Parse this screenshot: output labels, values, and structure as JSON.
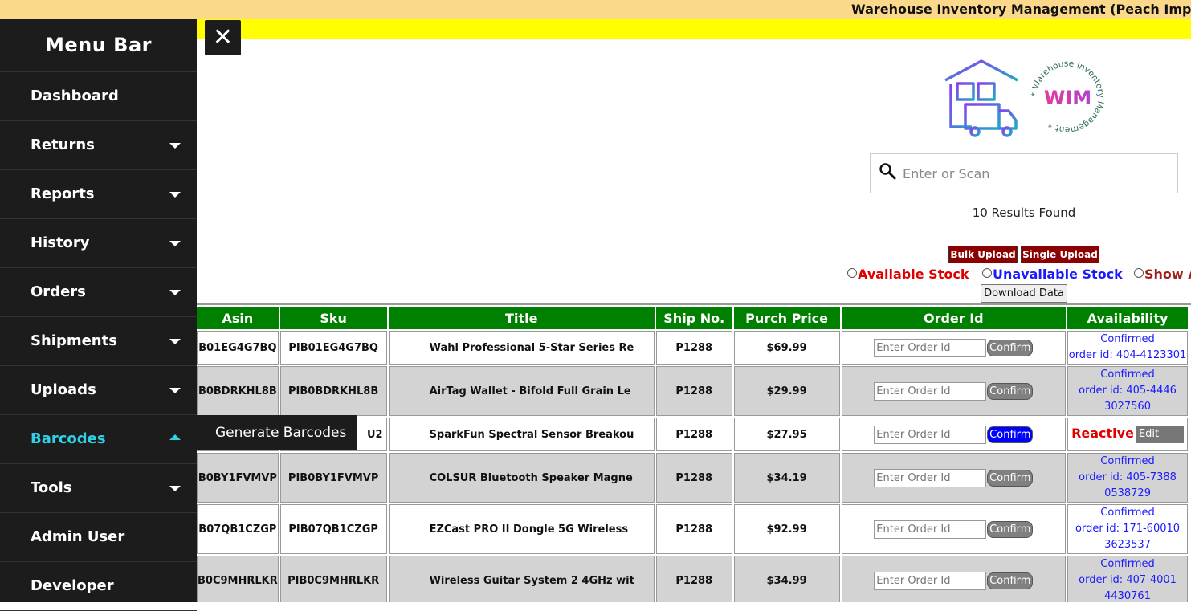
{
  "banner": {
    "title": "Warehouse Inventory Management (Peach Imports"
  },
  "sidebar": {
    "title": "Menu Bar",
    "items": [
      {
        "label": "Dashboard"
      },
      {
        "label": "Returns"
      },
      {
        "label": "Reports"
      },
      {
        "label": "History"
      },
      {
        "label": "Orders"
      },
      {
        "label": "Shipments"
      },
      {
        "label": "Uploads"
      },
      {
        "label": "Barcodes"
      },
      {
        "label": "Tools"
      },
      {
        "label": "Admin User"
      },
      {
        "label": "Developer"
      }
    ],
    "submenu_item": "Generate Barcodes",
    "active_color": "#2fd0e8"
  },
  "close_symbol": "✕",
  "logo": {
    "wim_text": "WIM",
    "wim_ring_text": "* Warehouse Inventory Management *"
  },
  "search": {
    "placeholder": "Enter or Scan"
  },
  "results_text": "10 Results Found",
  "buttons": {
    "bulk_upload": "Bulk Upload",
    "single_upload": "Single Upload",
    "download": "Download Data"
  },
  "filters": {
    "available": "Available Stock",
    "unavailable": "Unavailable Stock",
    "show_all": "Show A"
  },
  "table": {
    "headers": [
      "Asin",
      "Sku",
      "Title",
      "Ship No.",
      "Purch Price",
      "Order Id",
      "Availability"
    ],
    "order_placeholder": "Enter Order Id",
    "confirm_label": "Confirm",
    "edit_label": "Edit",
    "rows": [
      {
        "asin": "B01EG4G7BQ",
        "sku": "PIB01EG4G7BQ",
        "title": "Wahl Professional 5-Star Series Re",
        "ship": "P1288",
        "price": "$69.99",
        "avail1": "Confirmed",
        "avail2": "order id: 404-4123301",
        "avail3": ""
      },
      {
        "asin": "B0BDRKHL8B",
        "sku": "PIB0BDRKHL8B",
        "title": "AirTag Wallet - Bifold Full Grain Le",
        "ship": "P1288",
        "price": "$29.99",
        "avail1": "Confirmed",
        "avail2": "order id: 405-4446",
        "avail3": "3027560"
      },
      {
        "asin": "",
        "sku": "U2",
        "title": "SparkFun Spectral Sensor Breakou",
        "ship": "P1288",
        "price": "$27.95",
        "avail1": "Reactive",
        "avail2": "",
        "avail3": ""
      },
      {
        "asin": "B0BY1FVMVP",
        "sku": "PIB0BY1FVMVP",
        "title": "COLSUR Bluetooth Speaker  Magne",
        "ship": "P1288",
        "price": "$34.19",
        "avail1": "Confirmed",
        "avail2": "order id: 405-7388",
        "avail3": "0538729"
      },
      {
        "asin": "B07QB1CZGP",
        "sku": "PIB07QB1CZGP",
        "title": "EZCast PRO II Dongle  5G Wireless",
        "ship": "P1288",
        "price": "$92.99",
        "avail1": "Confirmed",
        "avail2": "order id: 171-60010",
        "avail3": "3623537"
      },
      {
        "asin": "B0C9MHRLKR",
        "sku": "PIB0C9MHRLKR",
        "title": "Wireless Guitar System 2 4GHz wit",
        "ship": "P1288",
        "price": "$34.99",
        "avail1": "Confirmed",
        "avail2": "order id: 407-4001",
        "avail3": "4430761"
      }
    ]
  }
}
